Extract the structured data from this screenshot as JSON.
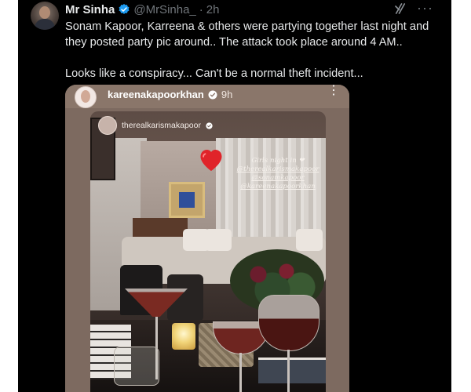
{
  "tweet": {
    "author_name": "Mr Sinha",
    "handle": "@MrSinha_",
    "separator": "·",
    "time": "2h",
    "text_line1": "Sonam Kapoor, Karreena & others were partying together last night and they posted party pic around.. The attack took place around 4 AM..",
    "text_line2": "Looks like a conspiracy... Can't be a normal theft incident...",
    "more_label": "···"
  },
  "instagram": {
    "username": "kareenakapoorkhan",
    "time": "9h",
    "more_label": "⋮",
    "story_username": "therealkarismakapoor",
    "caption_title": "Girls night in ❤",
    "caption_tags": [
      "@therealkarismakapoor",
      "@sonamkapoor",
      "@kareenakapoorkhan"
    ]
  },
  "icons": {
    "verified": "verified-badge-icon",
    "grok": "grok-icon",
    "heart": "heart-icon"
  },
  "colors": {
    "background": "#000000",
    "text": "#e7e9ea",
    "muted": "#71767b",
    "verified": "#1d9bf0",
    "heart": "#e0242a"
  }
}
